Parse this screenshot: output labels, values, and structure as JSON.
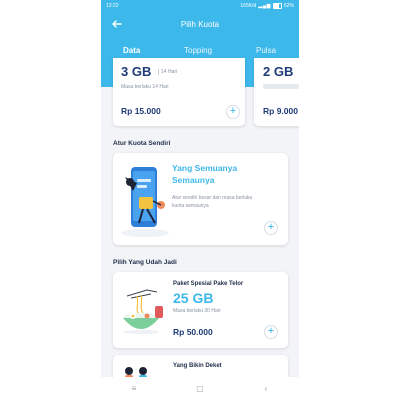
{
  "status": {
    "time": "13:22",
    "network": "165K/d",
    "battery": "62%"
  },
  "header": {
    "title": "Pilih Kuota"
  },
  "tabs": [
    {
      "label": "Data"
    },
    {
      "label": "Topping"
    },
    {
      "label": "Pulsa"
    }
  ],
  "top_packages": [
    {
      "size": "3 GB",
      "days": "14 Hari",
      "note": "Masa berlaku 14 Hari",
      "price": "Rp 15.000"
    },
    {
      "size": "2 GB",
      "price": "Rp 9.000"
    }
  ],
  "custom_section": {
    "title": "Atur Kuota Sendiri",
    "promo_title_line1": "Yang Semuanya",
    "promo_title_line2": "Semaunya",
    "desc_line1": "Atur sendiri besar dan masa berlaku",
    "desc_line2": "kuota semaunya"
  },
  "ready_section": {
    "title": "Pilih Yang Udah Jadi",
    "kits": [
      {
        "name": "Paket Spesial Pake Telor",
        "size": "25 GB",
        "note": "Masa berlaku 30 Hari",
        "price": "Rp 50.000"
      },
      {
        "name": "Yang Bikin Deket"
      }
    ]
  },
  "icons": {
    "back": "arrow-left-icon",
    "add": "plus-icon"
  },
  "colors": {
    "primary": "#3db8ea",
    "navy": "#1e3a78",
    "background": "#f3f4f7"
  }
}
